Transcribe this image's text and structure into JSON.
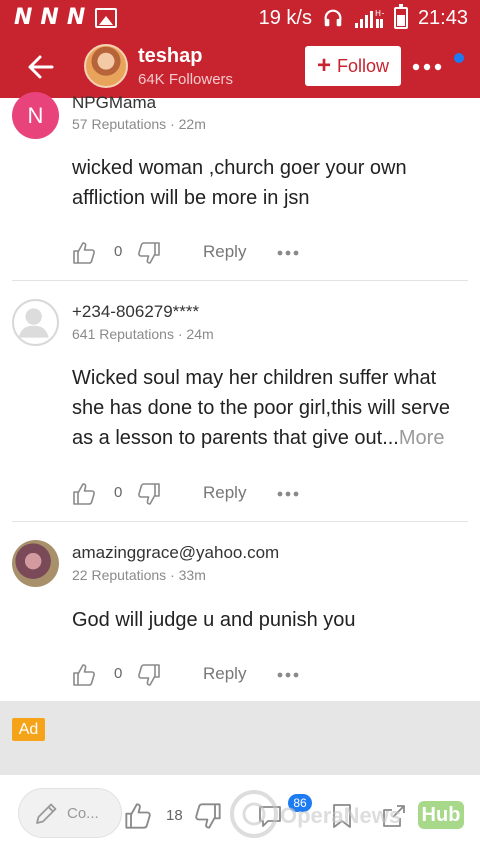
{
  "status_bar": {
    "speed": "19 k/s",
    "time": "21:43",
    "network_label": "H+",
    "carrier_marks": [
      "N",
      "N",
      "N"
    ]
  },
  "header": {
    "user_name": "teshap",
    "followers": "64K Followers",
    "follow_label": "Follow",
    "accent_color": "#c8242f",
    "notification_dot_color": "#1e7cf2"
  },
  "comments": [
    {
      "avatar_letter": "N",
      "author": "NPGMama",
      "meta": "57 Reputations · 22m",
      "text": "wicked woman ,church goer your own affliction will be more in jsn",
      "likes": "0",
      "reply_label": "Reply"
    },
    {
      "author": "+234-806279****",
      "meta": "641 Reputations · 24m",
      "text": "Wicked soul may her children suffer what she has done to the poor girl,this will serve as a lesson to parents that give out...",
      "more_label": "More",
      "likes": "0",
      "reply_label": "Reply"
    },
    {
      "author": "amazinggrace@yahoo.com",
      "meta": "22 Reputations · 33m",
      "text": "God will judge u and punish you",
      "likes": "0",
      "reply_label": "Reply"
    }
  ],
  "ad": {
    "badge": "Ad",
    "badge_color": "#f5a41a"
  },
  "bottom_bar": {
    "comment_placeholder": "Co...",
    "like_count": "18",
    "comment_count": "86"
  },
  "watermark": {
    "text": "OperaNews",
    "hub": "Hub"
  }
}
